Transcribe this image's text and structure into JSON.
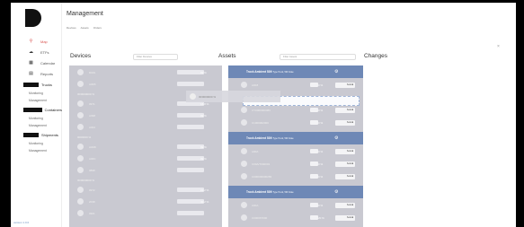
{
  "app": {
    "title": "Management",
    "version": "version 1.0.0",
    "breadcrumbs": [
      "Devices",
      "Assets",
      "Orders"
    ]
  },
  "sidebar": {
    "items": [
      {
        "label": "Map",
        "icon": "map-pin-icon",
        "active": true
      },
      {
        "label": "ETFs",
        "icon": "cloud-icon",
        "active": false
      },
      {
        "label": "Calendar",
        "icon": "calendar-icon",
        "active": false
      },
      {
        "label": "Reports",
        "icon": "chart-icon",
        "active": false
      }
    ],
    "groups": [
      {
        "label": "Trucks",
        "icon": "truck-icon",
        "subs": [
          "Monitoring",
          "Management"
        ]
      },
      {
        "label": "Containers",
        "icon": "container-icon",
        "subs": [
          "Monitoring",
          "Management"
        ]
      },
      {
        "label": "Shipments",
        "icon": "shipment-icon",
        "subs": [
          "Monitoring",
          "Management"
        ]
      }
    ]
  },
  "columns": {
    "devices": {
      "title": "Devices",
      "filter_placeholder": "Filter Devices"
    },
    "assets": {
      "title": "Assets",
      "filter_placeholder": "Filter Assets"
    },
    "changes": {
      "title": "Changes"
    }
  },
  "devices": {
    "rows": [
      {
        "name": "D001",
        "pct": "99 %"
      },
      {
        "name": "A0FB",
        "pct": ""
      },
      {
        "group": "ID/0000000 %"
      },
      {
        "name": "0971",
        "pct": "16.8 %"
      },
      {
        "name": "A098",
        "pct": "99 %"
      },
      {
        "name": "A002",
        "pct": ""
      },
      {
        "group": "0000000 %"
      },
      {
        "name": "A0AB",
        "pct": "99 %"
      },
      {
        "name": "A00C",
        "pct": "99 %"
      },
      {
        "name": "0898",
        "pct": ""
      },
      {
        "group": "ID/0000000 %"
      },
      {
        "name": "0972",
        "pct": "22.2 %"
      },
      {
        "name": "2038",
        "pct": "40.2 %"
      },
      {
        "name": "0901",
        "pct": ""
      }
    ]
  },
  "assets": {
    "groups": [
      {
        "title": "Truck Ambient 53ft",
        "subtitle": "Type Truck, 5W Crate",
        "rows": [
          {
            "name": "A0F8",
            "pct": "0 %",
            "select": "Select"
          },
          {
            "name": "",
            "pct": "",
            "select": ""
          },
          {
            "name": "CY0000000383",
            "pct": "0 %",
            "select": "Select"
          },
          {
            "name": "C1000002000",
            "pct": "0 %",
            "select": "Select"
          }
        ]
      },
      {
        "title": "Truck Ambient 53ft",
        "subtitle": "Type Truck, 5W Crate",
        "rows": [
          {
            "name": "A00A",
            "pct": "0 %",
            "select": "Select"
          },
          {
            "name": "C00A/T000001",
            "pct": "0 %",
            "select": "Select"
          },
          {
            "name": "C000000000283",
            "pct": "0 %",
            "select": "Select"
          }
        ]
      },
      {
        "title": "Truck Ambient 53ft",
        "subtitle": "Type Truck, 5W Crate",
        "rows": [
          {
            "name": "A00A",
            "pct": "0 %",
            "select": "Select"
          },
          {
            "name": "C000067000",
            "pct": "20 %",
            "select": "Select"
          }
        ]
      }
    ]
  },
  "drag_ghost": {
    "name": "ID/0000000 %",
    "pct": "17 %"
  }
}
